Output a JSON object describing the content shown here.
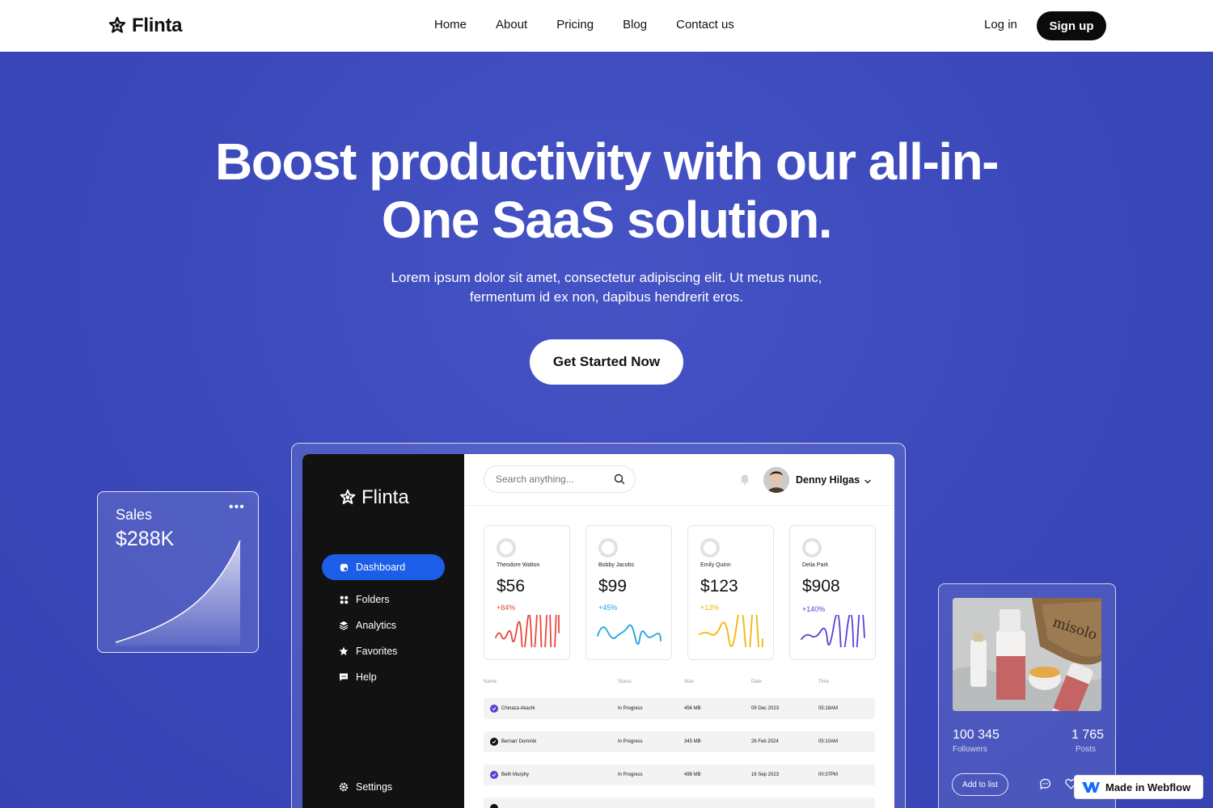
{
  "nav": {
    "brand": "Flinta",
    "links": [
      "Home",
      "About",
      "Pricing",
      "Blog",
      "Contact us"
    ],
    "login": "Log in",
    "signup": "Sign up"
  },
  "hero": {
    "title": "Boost productivity with our all-in-One SaaS solution.",
    "subtitle": "Lorem ipsum dolor sit amet, consectetur adipiscing elit. Ut metus nunc, fermentum id ex non, dapibus hendrerit eros.",
    "cta": "Get Started Now"
  },
  "sales_card": {
    "label": "Sales",
    "value": "$288K",
    "menu_icon": "more-horizontal-icon"
  },
  "dashboard": {
    "brand": "Flinta",
    "sidebar": {
      "items": [
        {
          "label": "Dashboard",
          "icon": "dashboard-icon",
          "active": true
        },
        {
          "label": "Folders",
          "icon": "folders-icon",
          "active": false
        },
        {
          "label": "Analytics",
          "icon": "layers-icon",
          "active": false
        },
        {
          "label": "Favorites",
          "icon": "star-icon",
          "active": false
        },
        {
          "label": "Help",
          "icon": "chat-icon",
          "active": false
        }
      ],
      "settings": "Settings"
    },
    "search_placeholder": "Search anything...",
    "user": {
      "name": "Denny Hilgas"
    },
    "stats": [
      {
        "name": "Theodore Walton",
        "value": "$56",
        "change": "+84%",
        "color": "#e8473a"
      },
      {
        "name": "Bobby Jacobs",
        "value": "$99",
        "change": "+45%",
        "color": "#1aa4e0"
      },
      {
        "name": "Emily Quinn",
        "value": "$123",
        "change": "+13%",
        "color": "#f2b705"
      },
      {
        "name": "Delia Park",
        "value": "$908",
        "change": "+140%",
        "color": "#5a3fd6"
      }
    ],
    "table": {
      "headers": [
        "Name",
        "Status",
        "Size",
        "Date",
        "Time"
      ],
      "rows": [
        {
          "name": "Chinaza Akachi",
          "status": "In Progress",
          "size": "456 MB",
          "date": "09 Dec 2023",
          "time": "05:18AM",
          "check_color": "#5a3fd6"
        },
        {
          "name": "Bernarr Dominik",
          "status": "In Progress",
          "size": "345 MB",
          "date": "26 Feb 2024",
          "time": "05:10AM",
          "check_color": "#111111"
        },
        {
          "name": "Beth Murphy",
          "status": "In Progress",
          "size": "498 MB",
          "date": "16 Sep 2023",
          "time": "00:37PM",
          "check_color": "#5a3fd6"
        }
      ]
    }
  },
  "social_card": {
    "followers_value": "100 345",
    "followers_label": "Followers",
    "posts_value": "1 765",
    "posts_label": "Posts",
    "add_to_list": "Add to list",
    "photo_text": "misolo"
  },
  "badge": {
    "text": "Made in Webflow"
  },
  "colors": {
    "hero_bg": "#3d4bbd",
    "active_blue": "#1c5ee8",
    "sidebar": "#121212"
  }
}
